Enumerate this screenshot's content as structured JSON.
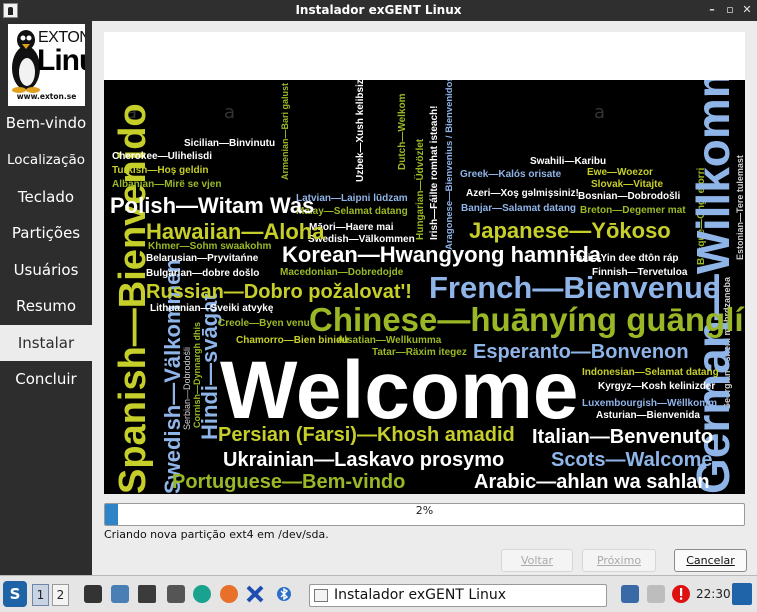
{
  "window": {
    "title": "Instalador exGENT Linux",
    "minimize_glyph": "–",
    "maximize_glyph": "▫",
    "close_glyph": "✕"
  },
  "logo": {
    "line1": "EXTON",
    "line2": "Linux",
    "url": "www.exton.se"
  },
  "sidebar": {
    "items": [
      {
        "label": "Bem-vindo",
        "active": false
      },
      {
        "label": "Localização",
        "active": false
      },
      {
        "label": "Teclado",
        "active": false
      },
      {
        "label": "Partições",
        "active": false
      },
      {
        "label": "Usuários",
        "active": false
      },
      {
        "label": "Resumo",
        "active": false
      },
      {
        "label": "Instalar",
        "active": true
      },
      {
        "label": "Concluir",
        "active": false
      }
    ]
  },
  "slideshow": {
    "headline": "Welcome",
    "words": [
      "Polish—Witam Was",
      "Hawaiian—Aloha",
      "Korean—Hwangyong hamnida",
      "French—Bienvenue",
      "Chinese—huānyíng guānglín",
      "Japanese—Yōkoso",
      "Russian—Dobro požalovat'!",
      "Esperanto—Bonvenon",
      "Persian (Farsi)—Khosh amadid",
      "Italian—Benvenuto",
      "Ukrainian—Laskavo prosymo",
      "Scots—Walcome",
      "Portuguese—Bem-vindo",
      "Arabic—ahlan wa sahlan",
      "German—Willkommen",
      "Spanish—Bienvenido",
      "Swedish—Välkommen",
      "Hindi—svāgat",
      "Sicilian—Binvinutu",
      "Cherokee—Ulihelisdi",
      "Turkish—Hoş geldin",
      "Albanian—Mirë se vjen",
      "Latvian—Laipni lūdzam",
      "Malay—Selamat datang",
      "Māori—Haere mai",
      "Greek—Kalós orisate",
      "Azeri—Xoş gəlmişsiniz!",
      "Banjar—Salamat datang",
      "Swahili—Karibu",
      "Bosnian—Dobrodošli",
      "Slovak—Vitajte",
      "Ewe—Woezor",
      "Breton—Degemer mat",
      "Khmer—Sohm swaakohm",
      "Belarusian—Pryvitańne",
      "Bulgarian—dobre došlo",
      "Macedonian—Dobredojde",
      "Thai—Yin dee dtôn ráp",
      "Finnish—Tervetuloa",
      "Lithuanian—Sveiki atvykę",
      "Creole—Byen venu",
      "Chamorro—Bien binidu",
      "Alsatian—Wellkumma",
      "Tatar—Räxim itegez",
      "Indonesian—Selamat datang",
      "Kyrgyz—Kosh kelinizder",
      "Luxembourgish—Wëllkomm",
      "Asturian—Bienvenida",
      "Serbian—Dobrodošli",
      "Cornish—Dynnargh dhis",
      "Armenian—Bari galust",
      "Uzbek—Xush kelibsiz",
      "Dutch—Welkom",
      "Hungarian—Üdvözlet",
      "Irish—Fáilte romhat isteach!",
      "Aragonese—Bienvenius / Bienvenidos",
      "Basque—Ongi etorri",
      "Estonian—Tere tulemast",
      "Georgian—sheni mobrdzaneba"
    ],
    "colors": {
      "white": "#ffffff",
      "blue": "#8fb4e8",
      "green": "#9ab826",
      "yellow": "#c6ce2a",
      "grey": "#d0d0d0"
    }
  },
  "progress": {
    "value": 0.02,
    "label": "2%",
    "status": "Criando nova partição ext4 em /dev/sda."
  },
  "buttons": {
    "back": "Voltar",
    "next": "Próximo",
    "cancel": "Cancelar"
  },
  "taskbar": {
    "workspaces": [
      "1",
      "2"
    ],
    "task_label": "Instalador exGENT Linux",
    "clock": "22:30",
    "start_glyph": "S",
    "icons": [
      "terminal-icon",
      "file-manager-icon",
      "monitor-icon",
      "settings-icon",
      "disk-icon",
      "firefox-icon",
      "x-icon",
      "bluetooth-icon"
    ]
  }
}
